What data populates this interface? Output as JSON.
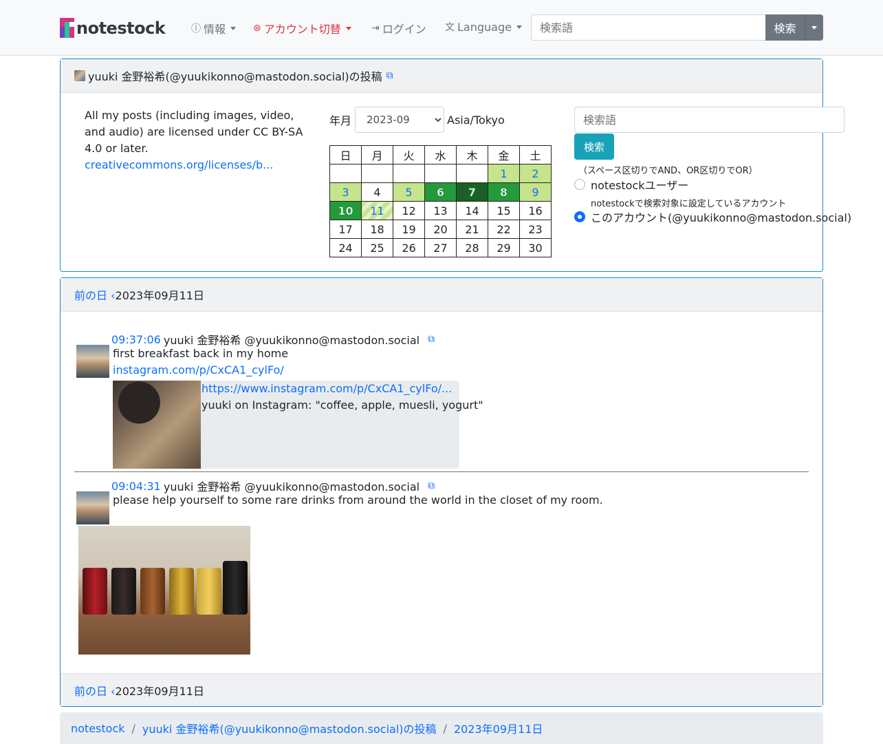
{
  "navbar": {
    "brand": "notestock",
    "info_label": "情報",
    "account_switch_label": "アカウント切替",
    "login_label": "ログイン",
    "language_label": "Language",
    "search_placeholder": "検索語",
    "search_button": "検索",
    "accent_color": "#dc3545"
  },
  "profile": {
    "header_title": "yuuki 金野裕希(@yuukikonno@mastodon.social)の投稿",
    "license_text": "All my posts (including images, video, and audio) are licensed under CC BY-SA 4.0 or later.",
    "license_link": "creativecommons.org/licenses/b..."
  },
  "calendar": {
    "ym_label": "年月",
    "selected_month": "2023-09",
    "timezone": "Asia/Tokyo",
    "weekdays": [
      "日",
      "月",
      "火",
      "水",
      "木",
      "金",
      "土"
    ],
    "days": [
      "1",
      "2",
      "3",
      "4",
      "5",
      "6",
      "7",
      "8",
      "9",
      "10",
      "11",
      "12",
      "13",
      "14",
      "15",
      "16",
      "17",
      "18",
      "19",
      "20",
      "21",
      "22",
      "23",
      "24",
      "25",
      "26",
      "27",
      "28",
      "29",
      "30"
    ]
  },
  "side_search": {
    "placeholder": "検索語",
    "button": "検索",
    "hint": "（スペース区切りでAND、OR区切りでOR）",
    "option_users": "notestockユーザー",
    "option_users_sub": "notestockで検索対象に設定しているアカウント",
    "option_account": "このアカウント(@yuukikonno@mastodon.social)"
  },
  "day_nav": {
    "prev_label": "前の日",
    "date": "2023年09月11日"
  },
  "posts": [
    {
      "time": "09:37:06",
      "author": "yuuki 金野裕希 @yuukikonno@mastodon.social",
      "text": "first breakfast back in my home",
      "link": "instagram.com/p/CxCA1_cylFo/",
      "embed_url": "https://www.instagram.com/p/CxCA1_cylFo/...",
      "embed_desc": "yuuki on Instagram: \"coffee, apple, muesli, yogurt\""
    },
    {
      "time": "09:04:31",
      "author": "yuuki 金野裕希 @yuukikonno@mastodon.social",
      "text": "please help yourself to some rare drinks from around the world in the closet of my room."
    }
  ],
  "breadcrumb": {
    "home": "notestock",
    "user": "yuuki 金野裕希(@yuukikonno@mastodon.social)の投稿",
    "date": "2023年09月11日"
  }
}
